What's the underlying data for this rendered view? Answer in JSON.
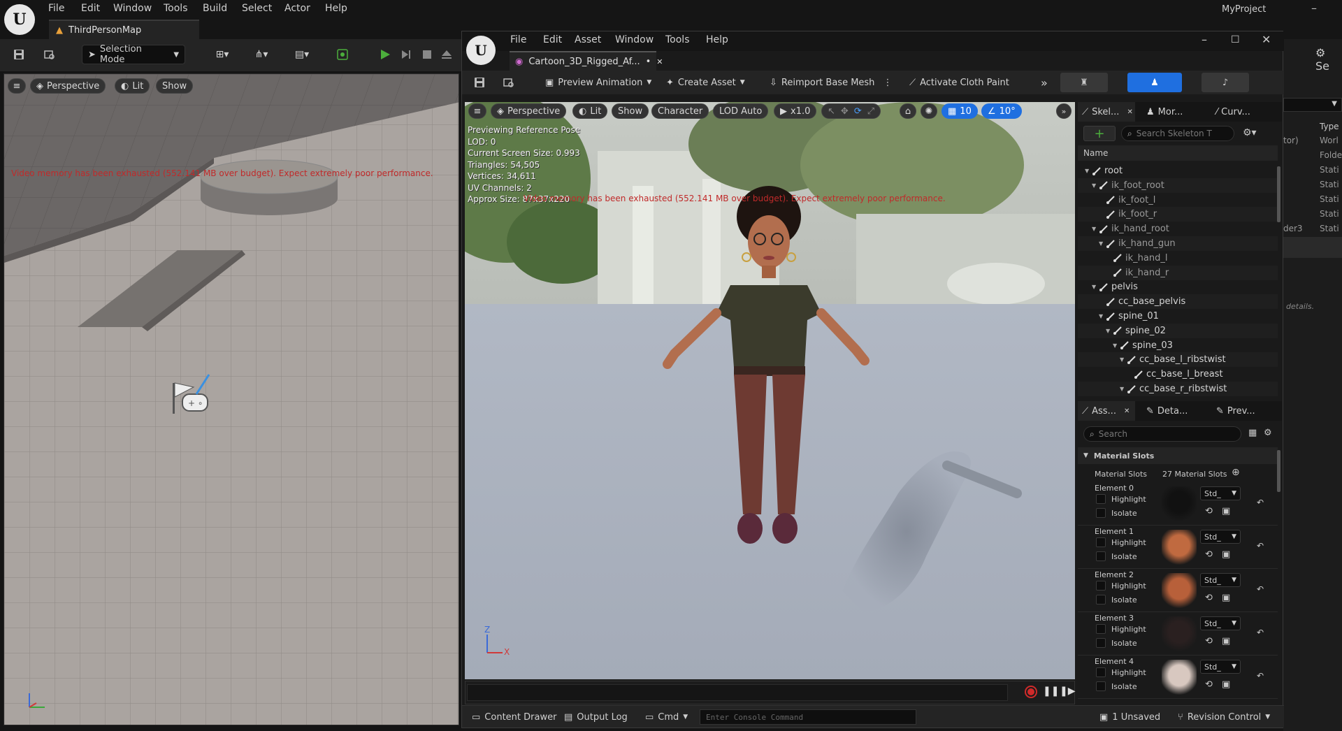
{
  "main": {
    "menu": [
      "File",
      "Edit",
      "Window",
      "Tools",
      "Build",
      "Select",
      "Actor",
      "Help"
    ],
    "project": "MyProject",
    "map_tab": "ThirdPersonMap",
    "selection_mode": "Selection Mode",
    "viewport": {
      "perspective": "Perspective",
      "lit": "Lit",
      "show": "Show",
      "warning": "Video memory has been exhausted (552.141 MB over budget). Expect extremely poor performance."
    }
  },
  "asset_editor": {
    "menu": [
      "File",
      "Edit",
      "Asset",
      "Window",
      "Tools",
      "Help"
    ],
    "tab_title": "Cartoon_3D_Rigged_Af...",
    "tab_dirty": "•",
    "toolbar": {
      "preview_animation": "Preview Animation",
      "create_asset": "Create Asset",
      "reimport": "Reimport Base Mesh",
      "cloth_paint": "Activate Cloth Paint"
    },
    "viewport": {
      "perspective": "Perspective",
      "lit": "Lit",
      "show": "Show",
      "character": "Character",
      "lod": "LOD Auto",
      "speed": "x1.0",
      "grid_value": "10",
      "angle_value": "10°",
      "info": [
        "Previewing Reference Pose",
        "LOD: 0",
        "Current Screen Size: 0.993",
        "Triangles: 54,505",
        "Vertices: 34,611",
        "UV Channels: 2",
        "Approx Size: 87x37x220"
      ],
      "warning": "Video memory has been exhausted (552.141 MB over budget). Expect extremely poor performance."
    },
    "skeleton_panel": {
      "tabs": [
        "Skel...",
        "Mor...",
        "Curv..."
      ],
      "search_placeholder": "Search Skeleton T",
      "column_name": "Name",
      "bones": [
        {
          "name": "root",
          "depth": 0,
          "expanded": true
        },
        {
          "name": "ik_foot_root",
          "depth": 1,
          "expanded": true
        },
        {
          "name": "ik_foot_l",
          "depth": 2,
          "expanded": false
        },
        {
          "name": "ik_foot_r",
          "depth": 2,
          "expanded": false
        },
        {
          "name": "ik_hand_root",
          "depth": 1,
          "expanded": true
        },
        {
          "name": "ik_hand_gun",
          "depth": 2,
          "expanded": true
        },
        {
          "name": "ik_hand_l",
          "depth": 3,
          "expanded": false
        },
        {
          "name": "ik_hand_r",
          "depth": 3,
          "expanded": false
        },
        {
          "name": "pelvis",
          "depth": 1,
          "expanded": true
        },
        {
          "name": "cc_base_pelvis",
          "depth": 2,
          "expanded": false
        },
        {
          "name": "spine_01",
          "depth": 2,
          "expanded": true
        },
        {
          "name": "spine_02",
          "depth": 3,
          "expanded": true
        },
        {
          "name": "spine_03",
          "depth": 4,
          "expanded": true
        },
        {
          "name": "cc_base_l_ribstwist",
          "depth": 5,
          "expanded": true
        },
        {
          "name": "cc_base_l_breast",
          "depth": 6,
          "expanded": false
        },
        {
          "name": "cc_base_r_ribstwist",
          "depth": 5,
          "expanded": true
        }
      ]
    },
    "details_panel": {
      "tabs": [
        "Ass...",
        "Deta...",
        "Prev..."
      ],
      "search_placeholder": "Search",
      "section": "Material Slots",
      "slots_label": "Material Slots",
      "slots_count": "27 Material Slots",
      "highlight": "Highlight",
      "isolate": "Isolate",
      "elements": [
        {
          "label": "Element 0",
          "material": "Std_"
        },
        {
          "label": "Element 1",
          "material": "Std_"
        },
        {
          "label": "Element 2",
          "material": "Std_"
        },
        {
          "label": "Element 3",
          "material": "Std_"
        },
        {
          "label": "Element 4",
          "material": "Std_"
        }
      ]
    },
    "axis": {
      "x": "X",
      "z": "Z"
    },
    "statusbar": {
      "content_drawer": "Content Drawer",
      "output_log": "Output Log",
      "cmd": "Cmd",
      "console_placeholder": "Enter Console Command",
      "unsaved": "1 Unsaved",
      "revision": "Revision Control"
    }
  },
  "right_outliner": {
    "type_header": "Type",
    "rows": [
      {
        "name": "tor)",
        "type": "Worl"
      },
      {
        "name": "",
        "type": "Folde"
      },
      {
        "name": "",
        "type": "Stati"
      },
      {
        "name": "",
        "type": "Stati"
      },
      {
        "name": "",
        "type": "Stati"
      },
      {
        "name": "",
        "type": "Stati"
      },
      {
        "name": "der3",
        "type": "Stati"
      }
    ],
    "details_hint": "details.",
    "settings": "Se"
  },
  "colors": {
    "accent_blue": "#1f6fe0",
    "play_green": "#4cae3c",
    "record_red": "#d02a2a",
    "warning_red": "#c02a2a",
    "panel_bg": "#1a1a1a"
  }
}
